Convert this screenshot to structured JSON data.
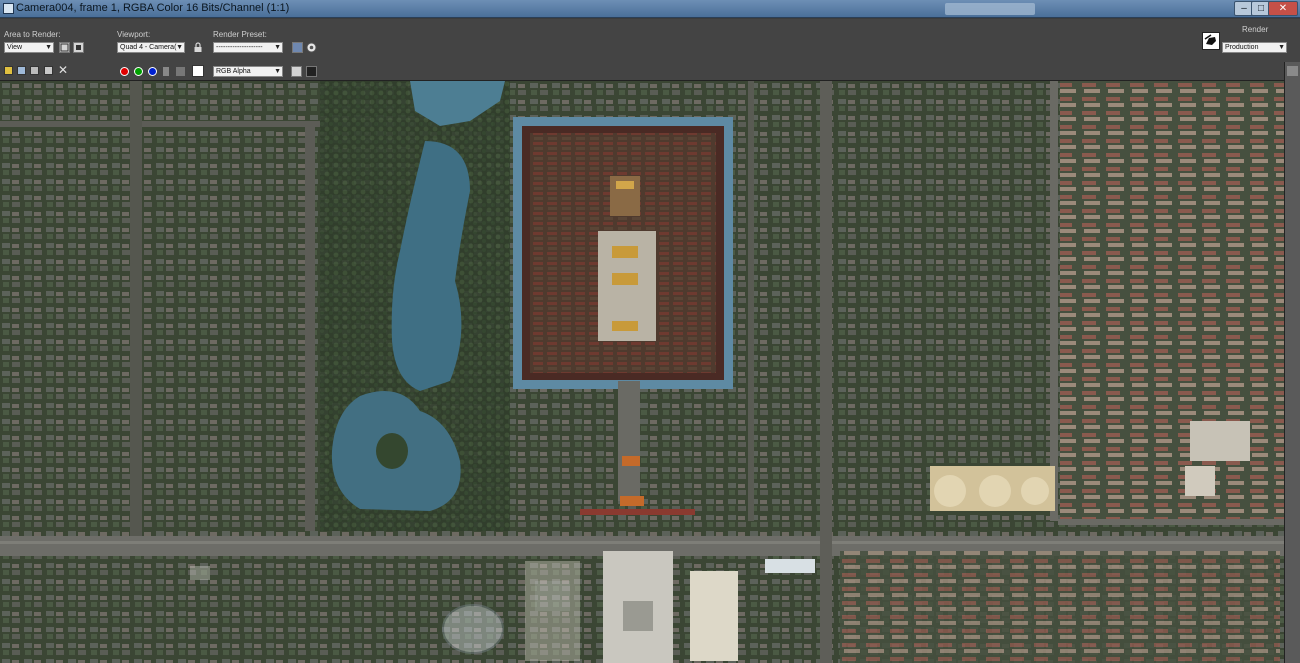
{
  "window": {
    "title": "Camera004, frame 1, RGBA Color 16 Bits/Channel (1:1)",
    "buttons": {
      "minimize": "–",
      "maximize": "□",
      "close": "✕"
    }
  },
  "toolbar": {
    "area_to_render": {
      "label": "Area to Render:",
      "value": "View"
    },
    "viewport": {
      "label": "Viewport:",
      "value": "Quad 4 - Camera("
    },
    "render_preset": {
      "label": "Render Preset:",
      "value": "--------------------"
    },
    "render": {
      "label": "Render",
      "mode": "Production"
    },
    "channel": {
      "value": "RGB Alpha"
    },
    "icons": [
      "save-icon",
      "copy-icon",
      "clone-icon",
      "print-icon",
      "clear-icon",
      "lock-icon",
      "environment-icon",
      "teapot-icon"
    ],
    "channel_colors": {
      "red": "#e00000",
      "green": "#00a000",
      "blue": "#0020d0"
    }
  },
  "viewport": {
    "content": "aerial-city-render",
    "colors": {
      "water": "#3f6f84",
      "greenery": "#3a4a32",
      "road": "#6d6d68",
      "wall": "#5b2b24",
      "palace_roof": "#c89a3a",
      "plaza": "#c9c7bf"
    }
  }
}
